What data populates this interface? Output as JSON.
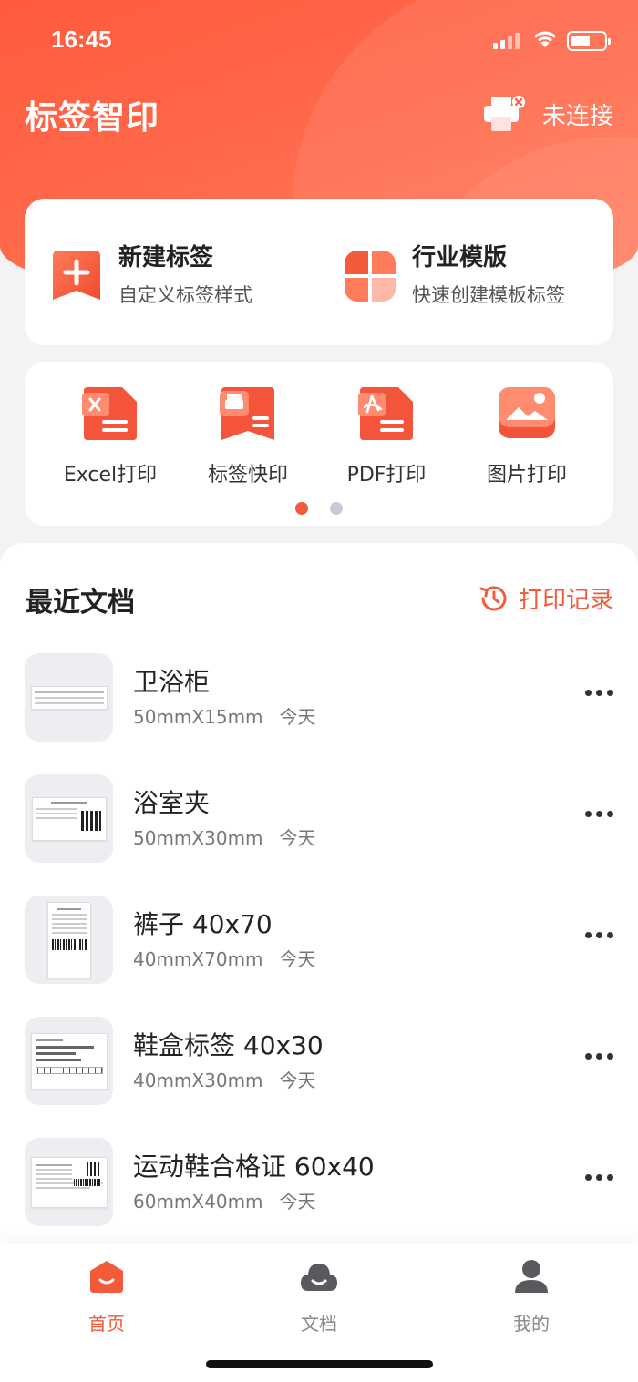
{
  "status_bar": {
    "time": "16:45"
  },
  "header": {
    "app_title": "标签智印",
    "printer_status": "未连接"
  },
  "quick_actions": [
    {
      "title": "新建标签",
      "subtitle": "自定义标签样式",
      "icon": "add-label-icon"
    },
    {
      "title": "行业模版",
      "subtitle": "快速创建模板标签",
      "icon": "template-grid-icon"
    }
  ],
  "tools": [
    {
      "label": "Excel打印",
      "icon": "excel-print-icon"
    },
    {
      "label": "标签快印",
      "icon": "quick-label-print-icon"
    },
    {
      "label": "PDF打印",
      "icon": "pdf-print-icon"
    },
    {
      "label": "图片打印",
      "icon": "image-print-icon"
    }
  ],
  "pager": {
    "pages": 2,
    "current": 1
  },
  "recent": {
    "title": "最近文档",
    "history_label": "打印记录",
    "items": [
      {
        "name": "卫浴柜",
        "size": "50mmX15mm",
        "date": "今天"
      },
      {
        "name": "浴室夹",
        "size": "50mmX30mm",
        "date": "今天"
      },
      {
        "name": "裤子 40x70",
        "size": "40mmX70mm",
        "date": "今天"
      },
      {
        "name": "鞋盒标签 40x30",
        "size": "40mmX30mm",
        "date": "今天"
      },
      {
        "name": "运动鞋合格证 60x40",
        "size": "60mmX40mm",
        "date": "今天"
      }
    ]
  },
  "tabbar": {
    "items": [
      {
        "label": "首页",
        "icon": "home-icon",
        "active": true
      },
      {
        "label": "文档",
        "icon": "cloud-document-icon",
        "active": false
      },
      {
        "label": "我的",
        "icon": "profile-icon",
        "active": false
      }
    ]
  },
  "colors": {
    "accent": "#f25a3a",
    "header_bg": "#ff5a3c",
    "page_bg": "#f3f3f5"
  }
}
